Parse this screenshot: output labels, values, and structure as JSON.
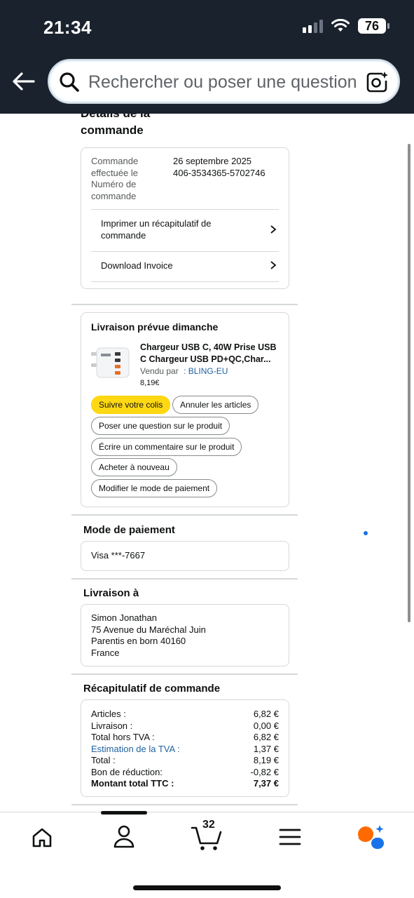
{
  "status_bar": {
    "time": "21:34",
    "battery": "76"
  },
  "search": {
    "placeholder": "Rechercher ou poser une question"
  },
  "order_details": {
    "title_line1": "Détails de la",
    "title_line2": "commande",
    "labels": [
      "Commande",
      "effectuée le",
      "Numéro de",
      "commande"
    ],
    "date": "26 septembre 2025",
    "number": "406-3534365-5702746",
    "print_summary_line1": "Imprimer un récapitulatif de",
    "print_summary_line2": "commande",
    "download_invoice": "Download Invoice"
  },
  "delivery": {
    "title": "Livraison prévue dimanche",
    "product_line1": "Chargeur USB C, 40W Prise USB",
    "product_line2": "C Chargeur USB PD+QC,Char...",
    "sold_by_label": "Vendu par",
    "seller": ": BLING-EU",
    "price": "8,19€",
    "actions": {
      "track": "Suivre votre colis",
      "cancel": "Annuler les articles",
      "ask": "Poser une question sur le produit",
      "review": "Écrire un commentaire sur le produit",
      "buy_again": "Acheter à nouveau",
      "change_payment": "Modifier le mode de paiement"
    }
  },
  "payment": {
    "title": "Mode de paiement",
    "method": "Visa ***-7667"
  },
  "shipping": {
    "title": "Livraison à",
    "name": "Simon Jonathan",
    "street": "75 Avenue du Maréchal Juin",
    "city": "Parentis en born 40160",
    "country": "France"
  },
  "summary": {
    "title": "Récapitulatif de commande",
    "rows": [
      {
        "label": "Articles :",
        "value": "6,82 €"
      },
      {
        "label": "Livraison :",
        "value": "0,00 €"
      },
      {
        "label": "Total hors TVA :",
        "value": "6,82 €"
      },
      {
        "label": "Estimation de la TVA :",
        "value": "1,37 €"
      },
      {
        "label": "Total :",
        "value": "8,19 €"
      },
      {
        "label": "Bon de réduction:",
        "value": "-0,82 €"
      },
      {
        "label": "Montant total TTC :",
        "value": "7,37 €"
      }
    ]
  },
  "bottom_nav": {
    "cart_count": "32"
  },
  "colors": {
    "header_bg": "#1a222d",
    "accent_yellow": "#ffd814",
    "link_blue": "#2162a1",
    "rufus_orange": "#ff6a00",
    "rufus_blue": "#1a73e8"
  }
}
